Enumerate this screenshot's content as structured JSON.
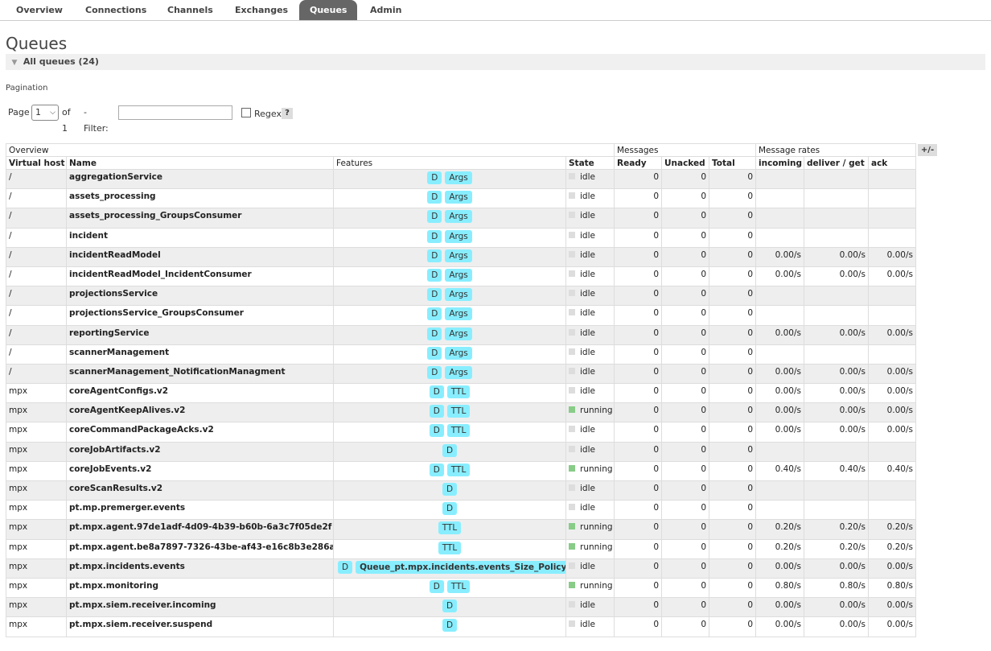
{
  "nav": {
    "tabs": [
      "Overview",
      "Connections",
      "Channels",
      "Exchanges",
      "Queues",
      "Admin"
    ],
    "active": "Queues"
  },
  "page_title": "Queues",
  "section": {
    "label": "All queues (24)"
  },
  "pagination": {
    "label": "Pagination",
    "page_label": "Page",
    "page_value": "1",
    "of_label": "of 1",
    "filter_label": "- Filter:",
    "filter_value": "",
    "regex_label": "Regex",
    "help_label": "?"
  },
  "table": {
    "group_headers": {
      "overview": "Overview",
      "messages": "Messages",
      "rates": "Message rates"
    },
    "headers": [
      "Virtual host",
      "Name",
      "Features",
      "State",
      "Ready",
      "Unacked",
      "Total",
      "incoming",
      "deliver / get",
      "ack"
    ],
    "toggle_columns_label": "+/-",
    "rows": [
      {
        "vhost": "/",
        "name": "aggregationService",
        "features": [
          "D",
          "Args"
        ],
        "state": "idle",
        "ready": "0",
        "unacked": "0",
        "total": "0",
        "incoming": "",
        "deliver": "",
        "ack": ""
      },
      {
        "vhost": "/",
        "name": "assets_processing",
        "features": [
          "D",
          "Args"
        ],
        "state": "idle",
        "ready": "0",
        "unacked": "0",
        "total": "0",
        "incoming": "",
        "deliver": "",
        "ack": ""
      },
      {
        "vhost": "/",
        "name": "assets_processing_GroupsConsumer",
        "features": [
          "D",
          "Args"
        ],
        "state": "idle",
        "ready": "0",
        "unacked": "0",
        "total": "0",
        "incoming": "",
        "deliver": "",
        "ack": ""
      },
      {
        "vhost": "/",
        "name": "incident",
        "features": [
          "D",
          "Args"
        ],
        "state": "idle",
        "ready": "0",
        "unacked": "0",
        "total": "0",
        "incoming": "",
        "deliver": "",
        "ack": ""
      },
      {
        "vhost": "/",
        "name": "incidentReadModel",
        "features": [
          "D",
          "Args"
        ],
        "state": "idle",
        "ready": "0",
        "unacked": "0",
        "total": "0",
        "incoming": "0.00/s",
        "deliver": "0.00/s",
        "ack": "0.00/s"
      },
      {
        "vhost": "/",
        "name": "incidentReadModel_IncidentConsumer",
        "features": [
          "D",
          "Args"
        ],
        "state": "idle",
        "ready": "0",
        "unacked": "0",
        "total": "0",
        "incoming": "0.00/s",
        "deliver": "0.00/s",
        "ack": "0.00/s"
      },
      {
        "vhost": "/",
        "name": "projectionsService",
        "features": [
          "D",
          "Args"
        ],
        "state": "idle",
        "ready": "0",
        "unacked": "0",
        "total": "0",
        "incoming": "",
        "deliver": "",
        "ack": ""
      },
      {
        "vhost": "/",
        "name": "projectionsService_GroupsConsumer",
        "features": [
          "D",
          "Args"
        ],
        "state": "idle",
        "ready": "0",
        "unacked": "0",
        "total": "0",
        "incoming": "",
        "deliver": "",
        "ack": ""
      },
      {
        "vhost": "/",
        "name": "reportingService",
        "features": [
          "D",
          "Args"
        ],
        "state": "idle",
        "ready": "0",
        "unacked": "0",
        "total": "0",
        "incoming": "0.00/s",
        "deliver": "0.00/s",
        "ack": "0.00/s"
      },
      {
        "vhost": "/",
        "name": "scannerManagement",
        "features": [
          "D",
          "Args"
        ],
        "state": "idle",
        "ready": "0",
        "unacked": "0",
        "total": "0",
        "incoming": "",
        "deliver": "",
        "ack": ""
      },
      {
        "vhost": "/",
        "name": "scannerManagement_NotificationManagment",
        "features": [
          "D",
          "Args"
        ],
        "state": "idle",
        "ready": "0",
        "unacked": "0",
        "total": "0",
        "incoming": "0.00/s",
        "deliver": "0.00/s",
        "ack": "0.00/s"
      },
      {
        "vhost": "mpx",
        "name": "coreAgentConfigs.v2",
        "features": [
          "D",
          "TTL"
        ],
        "state": "idle",
        "ready": "0",
        "unacked": "0",
        "total": "0",
        "incoming": "0.00/s",
        "deliver": "0.00/s",
        "ack": "0.00/s"
      },
      {
        "vhost": "mpx",
        "name": "coreAgentKeepAlives.v2",
        "features": [
          "D",
          "TTL"
        ],
        "state": "running",
        "ready": "0",
        "unacked": "0",
        "total": "0",
        "incoming": "0.00/s",
        "deliver": "0.00/s",
        "ack": "0.00/s"
      },
      {
        "vhost": "mpx",
        "name": "coreCommandPackageAcks.v2",
        "features": [
          "D",
          "TTL"
        ],
        "state": "idle",
        "ready": "0",
        "unacked": "0",
        "total": "0",
        "incoming": "0.00/s",
        "deliver": "0.00/s",
        "ack": "0.00/s"
      },
      {
        "vhost": "mpx",
        "name": "coreJobArtifacts.v2",
        "features": [
          "D"
        ],
        "state": "idle",
        "ready": "0",
        "unacked": "0",
        "total": "0",
        "incoming": "",
        "deliver": "",
        "ack": ""
      },
      {
        "vhost": "mpx",
        "name": "coreJobEvents.v2",
        "features": [
          "D",
          "TTL"
        ],
        "state": "running",
        "ready": "0",
        "unacked": "0",
        "total": "0",
        "incoming": "0.40/s",
        "deliver": "0.40/s",
        "ack": "0.40/s"
      },
      {
        "vhost": "mpx",
        "name": "coreScanResults.v2",
        "features": [
          "D"
        ],
        "state": "idle",
        "ready": "0",
        "unacked": "0",
        "total": "0",
        "incoming": "",
        "deliver": "",
        "ack": ""
      },
      {
        "vhost": "mpx",
        "name": "pt.mp.premerger.events",
        "features": [
          "D"
        ],
        "state": "idle",
        "ready": "0",
        "unacked": "0",
        "total": "0",
        "incoming": "",
        "deliver": "",
        "ack": ""
      },
      {
        "vhost": "mpx",
        "name": "pt.mpx.agent.97de1adf-4d09-4b39-b60b-6a3c7f05de2f",
        "features": [
          "TTL"
        ],
        "state": "running",
        "ready": "0",
        "unacked": "0",
        "total": "0",
        "incoming": "0.20/s",
        "deliver": "0.20/s",
        "ack": "0.20/s"
      },
      {
        "vhost": "mpx",
        "name": "pt.mpx.agent.be8a7897-7326-43be-af43-e16c8b3e286a",
        "features": [
          "TTL"
        ],
        "state": "running",
        "ready": "0",
        "unacked": "0",
        "total": "0",
        "incoming": "0.20/s",
        "deliver": "0.20/s",
        "ack": "0.20/s"
      },
      {
        "vhost": "mpx",
        "name": "pt.mpx.incidents.events",
        "features": [
          "D",
          "Queue_pt.mpx.incidents.events_Size_Policy"
        ],
        "state": "idle",
        "ready": "0",
        "unacked": "0",
        "total": "0",
        "incoming": "0.00/s",
        "deliver": "0.00/s",
        "ack": "0.00/s"
      },
      {
        "vhost": "mpx",
        "name": "pt.mpx.monitoring",
        "features": [
          "D",
          "TTL"
        ],
        "state": "running",
        "ready": "0",
        "unacked": "0",
        "total": "0",
        "incoming": "0.80/s",
        "deliver": "0.80/s",
        "ack": "0.80/s"
      },
      {
        "vhost": "mpx",
        "name": "pt.mpx.siem.receiver.incoming",
        "features": [
          "D"
        ],
        "state": "idle",
        "ready": "0",
        "unacked": "0",
        "total": "0",
        "incoming": "0.00/s",
        "deliver": "0.00/s",
        "ack": "0.00/s"
      },
      {
        "vhost": "mpx",
        "name": "pt.mpx.siem.receiver.suspend",
        "features": [
          "D"
        ],
        "state": "idle",
        "ready": "0",
        "unacked": "0",
        "total": "0",
        "incoming": "0.00/s",
        "deliver": "0.00/s",
        "ack": "0.00/s"
      }
    ]
  }
}
